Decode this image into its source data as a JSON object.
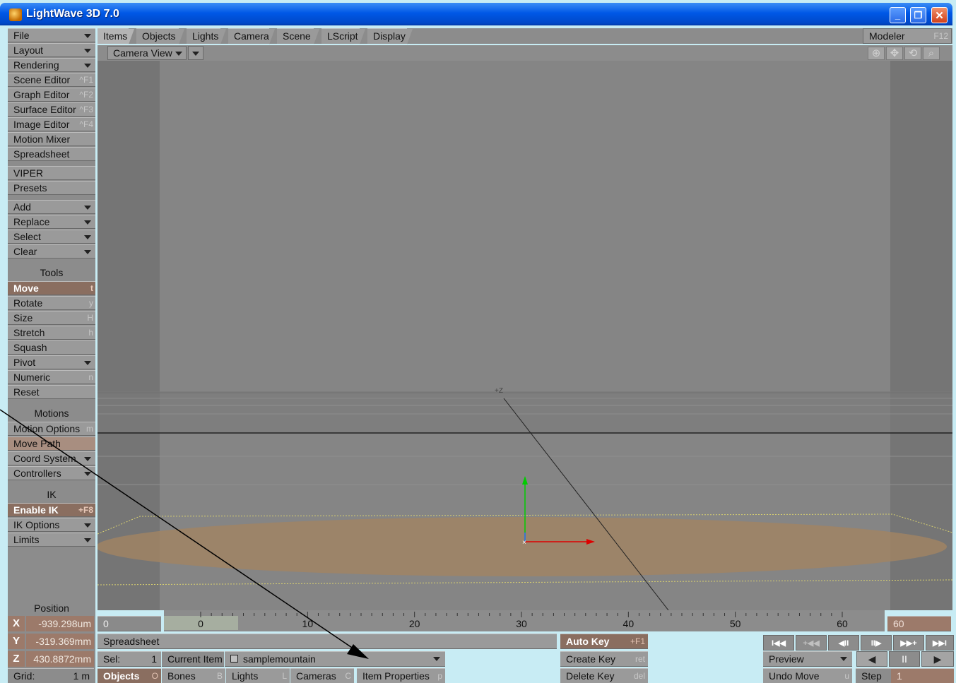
{
  "window": {
    "title": "LightWave 3D 7.0",
    "minimize": "_",
    "maximize": "❐",
    "close": "✕"
  },
  "left_panel": {
    "menus": [
      {
        "label": "File"
      },
      {
        "label": "Layout"
      },
      {
        "label": "Rendering"
      },
      {
        "label": "Scene Editor",
        "shortcut": "^F1"
      },
      {
        "label": "Graph Editor",
        "shortcut": "^F2"
      },
      {
        "label": "Surface Editor",
        "shortcut": "^F3"
      },
      {
        "label": "Image Editor",
        "shortcut": "^F4"
      },
      {
        "label": "Motion Mixer"
      },
      {
        "label": "Spreadsheet"
      },
      {
        "label": "VIPER"
      },
      {
        "label": "Presets"
      },
      {
        "label": "Add"
      },
      {
        "label": "Replace"
      },
      {
        "label": "Select"
      },
      {
        "label": "Clear"
      }
    ],
    "tools_header": "Tools",
    "tools": [
      {
        "label": "Move",
        "shortcut": "t"
      },
      {
        "label": "Rotate",
        "shortcut": "y"
      },
      {
        "label": "Size",
        "shortcut": "H"
      },
      {
        "label": "Stretch",
        "shortcut": "h"
      },
      {
        "label": "Squash"
      },
      {
        "label": "Pivot"
      },
      {
        "label": "Numeric",
        "shortcut": "n"
      },
      {
        "label": "Reset"
      }
    ],
    "motions_header": "Motions",
    "motions": [
      {
        "label": "Motion Options",
        "shortcut": "m"
      },
      {
        "label": "Move Path"
      },
      {
        "label": "Coord System"
      },
      {
        "label": "Controllers"
      }
    ],
    "ik_header": "IK",
    "ik": [
      {
        "label": "Enable IK",
        "shortcut": "+F8"
      },
      {
        "label": "IK Options"
      },
      {
        "label": "Limits"
      }
    ],
    "position_header": "Position"
  },
  "tabs": [
    "Items",
    "Objects",
    "Lights",
    "Camera",
    "Scene",
    "LScript",
    "Display"
  ],
  "modeler": {
    "label": "Modeler",
    "shortcut": "F12"
  },
  "viewport": {
    "view": "Camera View",
    "axis_label": "+Z"
  },
  "timeline": {
    "start": "0",
    "end": "60",
    "current_frame": "0",
    "ticks": [
      "0",
      "10",
      "20",
      "30",
      "40",
      "50",
      "60"
    ],
    "max_frame": 60
  },
  "position": {
    "x_label": "X",
    "x_value": "-939.298um",
    "y_label": "Y",
    "y_value": "-319.369mm",
    "z_label": "Z",
    "z_value": "430.8872mm",
    "grid_label": "Grid:",
    "grid_value": "1 m"
  },
  "status": {
    "spreadsheet": "Spreadsheet",
    "sel_label": "Sel:",
    "sel_value": "1",
    "current_item_label": "Current Item",
    "current_item_value": "samplemountain",
    "item_properties": "Item Properties",
    "item_properties_shortcut": "p"
  },
  "filters": [
    {
      "label": "Objects",
      "shortcut": "O"
    },
    {
      "label": "Bones",
      "shortcut": "B"
    },
    {
      "label": "Lights",
      "shortcut": "L"
    },
    {
      "label": "Cameras",
      "shortcut": "C"
    }
  ],
  "keys": {
    "auto_key": "Auto Key",
    "auto_key_shortcut": "+F1",
    "create_key": "Create Key",
    "create_key_shortcut": "ret",
    "delete_key": "Delete Key",
    "delete_key_shortcut": "del"
  },
  "transport": {
    "first": "I◀◀",
    "prev_key": "+◀◀",
    "prev_frame": "◀II",
    "next_frame": "II▶",
    "next_key": "▶▶+",
    "last": "▶▶I",
    "preview": "Preview",
    "rewind": "◀",
    "pause": "II",
    "play": "▶",
    "undo": "Undo Move",
    "undo_shortcut": "u",
    "step_label": "Step",
    "step_value": "1"
  },
  "colors": {
    "active_button": "#8a6e60",
    "panel": "#9a9a9a",
    "viewport": "#858585",
    "ground": "#a08464"
  }
}
